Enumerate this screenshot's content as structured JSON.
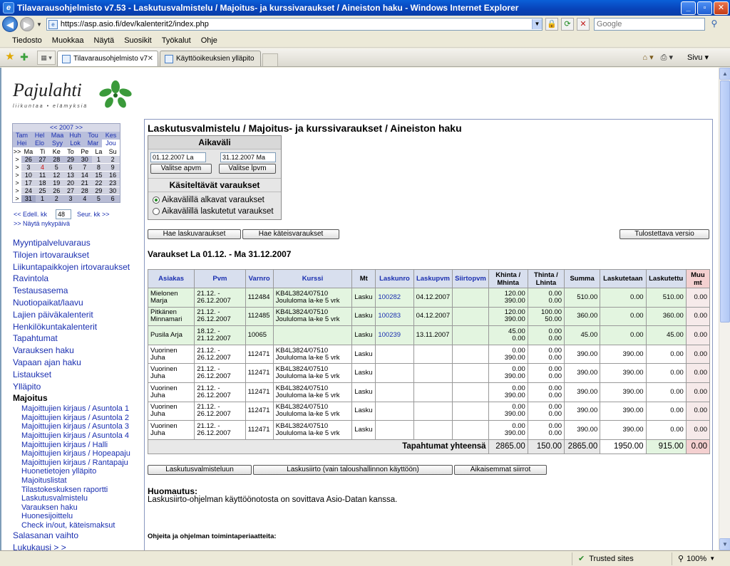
{
  "window": {
    "title": "Tilavarausohjelmisto v7.53 - Laskutusvalmistelu / Majoitus- ja kurssivaraukset / Aineiston haku - Windows Internet Explorer"
  },
  "address": {
    "url": "https://asp.asio.fi/dev/kalenterit2/index.php",
    "search_placeholder": "Google"
  },
  "menu": [
    "Tiedosto",
    "Muokkaa",
    "Näytä",
    "Suosikit",
    "Työkalut",
    "Ohje"
  ],
  "tabs": [
    {
      "label": "Tilavarausohjelmisto v7.5..."
    },
    {
      "label": "Käyttöoikeuksien ylläpito - Yll..."
    }
  ],
  "tab_tools": {
    "page": "Sivu"
  },
  "status": {
    "zone": "Trusted sites",
    "zoom": "100%"
  },
  "logo": {
    "name": "Pajulahti",
    "tagline": "liikuntaa • elämyksiä"
  },
  "calendar": {
    "year_nav": "<< 2007 >>",
    "months": [
      "Tam",
      "Hel",
      "Maa",
      "Huh",
      "Tou",
      "Kes",
      "Hei",
      "Elo",
      "Syy",
      "Lok",
      "Mar",
      "Jou"
    ],
    "weekday_header": [
      ">>",
      "Ma",
      "Ti",
      "Ke",
      "To",
      "Pe",
      "La",
      "Su"
    ],
    "weeks": [
      [
        ">",
        "26",
        "27",
        "28",
        "29",
        "30",
        "1",
        "2"
      ],
      [
        ">",
        "3",
        "4",
        "5",
        "6",
        "7",
        "8",
        "9"
      ],
      [
        ">",
        "10",
        "11",
        "12",
        "13",
        "14",
        "15",
        "16"
      ],
      [
        ">",
        "17",
        "18",
        "19",
        "20",
        "21",
        "22",
        "23"
      ],
      [
        ">",
        "24",
        "25",
        "26",
        "27",
        "28",
        "29",
        "30"
      ],
      [
        ">",
        "31",
        "1",
        "2",
        "3",
        "4",
        "5",
        "6"
      ]
    ],
    "prev_week": "<< Edell. kk",
    "week_value": "48",
    "next_week": "Seur. kk >>",
    "today": ">> Näytä nykypäivä"
  },
  "nav": {
    "items": [
      "Myyntipalveluvaraus",
      "Tilojen irtovaraukset",
      "Liikuntapaikkojen irtovaraukset",
      "Ravintola",
      "Testausasema",
      "Nuotiopaikat/laavu",
      "Lajien päiväkalenterit",
      "Henkilökuntakalenterit",
      "Tapahtumat",
      "Varauksen haku",
      "Vapaan ajan haku",
      "Listaukset",
      "Ylläpito"
    ],
    "section": "Majoitus",
    "sub_items": [
      "Majoittujien kirjaus / Asuntola 1",
      "Majoittujien kirjaus / Asuntola 2",
      "Majoittujien kirjaus / Asuntola 3",
      "Majoittujien kirjaus / Asuntola 4",
      "Majoittujien kirjaus / Halli",
      "Majoittujien kirjaus / Hopeapaju",
      "Majoittujien kirjaus / Rantapaju",
      "Huonetietojen ylläpito",
      "Majoituslistat",
      "Tilastokeskuksen raportti",
      "Laskutusvalmistelu",
      "Varauksen haku",
      "Huonesijoittelu",
      "Check in/out, käteismaksut"
    ],
    "after": "Salasanan vaihto",
    "cut": "Lukukausi > >"
  },
  "main": {
    "title": "Laskutusvalmistelu / Majoitus- ja kurssivaraukset / Aineiston haku",
    "aikavali": {
      "heading": "Aikaväli",
      "start_date": "01.12.2007 La",
      "end_date": "31.12.2007 Ma",
      "start_btn": "Valitse apvm",
      "end_btn": "Valitse lpvm",
      "subheading": "Käsiteltävät varaukset",
      "radio1": "Aikavälillä alkavat varaukset",
      "radio2": "Aikavälillä laskutetut varaukset"
    },
    "buttons": {
      "hae_lasku": "Hae laskuvaraukset",
      "hae_kateis": "Hae käteisvaraukset",
      "tulostettava": "Tulostettava versio",
      "laskutusvalmisteluun": "Laskutusvalmisteluun",
      "laskusiirto": "Laskusiirto (vain taloushallinnon käyttöön)",
      "aikaisemmat": "Aikaisemmat siirrot"
    },
    "subtitle": "Varaukset La 01.12. - Ma 31.12.2007",
    "table": {
      "headers": {
        "asiakas": "Asiakas",
        "pvm": "Pvm",
        "varnro": "Varnro",
        "kurssi": "Kurssi",
        "mt": "Mt",
        "laskunro": "Laskunro",
        "laskupvm": "Laskupvm",
        "siirtopvm": "Siirtopvm",
        "khinta": "Khinta / Mhinta",
        "thinta": "Thinta / Lhinta",
        "summa": "Summa",
        "laskutetaan": "Laskutetaan",
        "laskutettu": "Laskutettu",
        "muut": "Muu mt"
      },
      "rows": [
        {
          "asiakas": "Mielonen Marja",
          "pvm": "21.12. - 26.12.2007",
          "varnro": "112484",
          "kurssi": "KB4L3824/07510 Joululoma la-ke 5 vrk",
          "mt": "Lasku",
          "laskunro": "100282",
          "laskupvm": "04.12.2007",
          "siirtopvm": "",
          "khinta": "120.00",
          "mhinta": "390.00",
          "thinta": "0.00",
          "lhinta": "0.00",
          "summa": "510.00",
          "laskutetaan": "0.00",
          "laskutettu": "510.00",
          "muut": "0.00",
          "style": "green"
        },
        {
          "asiakas": "Pitkänen Minnamari",
          "pvm": "21.12. - 26.12.2007",
          "varnro": "112485",
          "kurssi": "KB4L3824/07510 Joululoma la-ke 5 vrk",
          "mt": "Lasku",
          "laskunro": "100283",
          "laskupvm": "04.12.2007",
          "siirtopvm": "",
          "khinta": "120.00",
          "mhinta": "390.00",
          "thinta": "100.00",
          "lhinta": "50.00",
          "summa": "360.00",
          "laskutetaan": "0.00",
          "laskutettu": "360.00",
          "muut": "0.00",
          "style": "green"
        },
        {
          "asiakas": "Pusila Arja",
          "pvm": "18.12. - 21.12.2007",
          "varnro": "10065",
          "kurssi": "",
          "mt": "Lasku",
          "laskunro": "100239",
          "laskupvm": "13.11.2007",
          "siirtopvm": "",
          "khinta": "45.00",
          "mhinta": "0.00",
          "thinta": "0.00",
          "lhinta": "0.00",
          "summa": "45.00",
          "laskutetaan": "0.00",
          "laskutettu": "45.00",
          "muut": "0.00",
          "style": "green"
        },
        {
          "asiakas": "Vuorinen Juha",
          "pvm": "21.12. - 26.12.2007",
          "varnro": "112471",
          "kurssi": "KB4L3824/07510 Joululoma la-ke 5 vrk",
          "mt": "Lasku",
          "laskunro": "",
          "laskupvm": "",
          "siirtopvm": "",
          "khinta": "0.00",
          "mhinta": "390.00",
          "thinta": "0.00",
          "lhinta": "0.00",
          "summa": "390.00",
          "laskutetaan": "390.00",
          "laskutettu": "0.00",
          "muut": "0.00",
          "style": "white"
        },
        {
          "asiakas": "Vuorinen Juha",
          "pvm": "21.12. - 26.12.2007",
          "varnro": "112471",
          "kurssi": "KB4L3824/07510 Joululoma la-ke 5 vrk",
          "mt": "Lasku",
          "laskunro": "",
          "laskupvm": "",
          "siirtopvm": "",
          "khinta": "0.00",
          "mhinta": "390.00",
          "thinta": "0.00",
          "lhinta": "0.00",
          "summa": "390.00",
          "laskutetaan": "390.00",
          "laskutettu": "0.00",
          "muut": "0.00",
          "style": "white"
        },
        {
          "asiakas": "Vuorinen Juha",
          "pvm": "21.12. - 26.12.2007",
          "varnro": "112471",
          "kurssi": "KB4L3824/07510 Joululoma la-ke 5 vrk",
          "mt": "Lasku",
          "laskunro": "",
          "laskupvm": "",
          "siirtopvm": "",
          "khinta": "0.00",
          "mhinta": "390.00",
          "thinta": "0.00",
          "lhinta": "0.00",
          "summa": "390.00",
          "laskutetaan": "390.00",
          "laskutettu": "0.00",
          "muut": "0.00",
          "style": "white"
        },
        {
          "asiakas": "Vuorinen Juha",
          "pvm": "21.12. - 26.12.2007",
          "varnro": "112471",
          "kurssi": "KB4L3824/07510 Joululoma la-ke 5 vrk",
          "mt": "Lasku",
          "laskunro": "",
          "laskupvm": "",
          "siirtopvm": "",
          "khinta": "0.00",
          "mhinta": "390.00",
          "thinta": "0.00",
          "lhinta": "0.00",
          "summa": "390.00",
          "laskutetaan": "390.00",
          "laskutettu": "0.00",
          "muut": "0.00",
          "style": "white"
        },
        {
          "asiakas": "Vuorinen Juha",
          "pvm": "21.12. - 26.12.2007",
          "varnro": "112471",
          "kurssi": "KB4L3824/07510 Joululoma la-ke 5 vrk",
          "mt": "Lasku",
          "laskunro": "",
          "laskupvm": "",
          "siirtopvm": "",
          "khinta": "0.00",
          "mhinta": "390.00",
          "thinta": "0.00",
          "lhinta": "0.00",
          "summa": "390.00",
          "laskutetaan": "390.00",
          "laskutettu": "0.00",
          "muut": "0.00",
          "style": "white"
        }
      ],
      "totals": {
        "label": "Tapahtumat yhteensä",
        "khinta": "2865.00",
        "thinta": "150.00",
        "summa": "2865.00",
        "laskutetaan": "1950.00",
        "laskutettu": "915.00",
        "muut": "0.00"
      }
    },
    "note_title": "Huomautus:",
    "note_text": "Laskusiirto-ohjelman käyttöönotosta on sovittava Asio-Datan kanssa.",
    "ohjeita": "Ohjeita ja ohjelman toimintaperiaatteita:"
  },
  "colors": {
    "title_blue": "#0a5fd8",
    "link_blue": "#1a2fb0",
    "row_green": "#e3f5e0",
    "muut_pink": "#f4d0d0"
  }
}
